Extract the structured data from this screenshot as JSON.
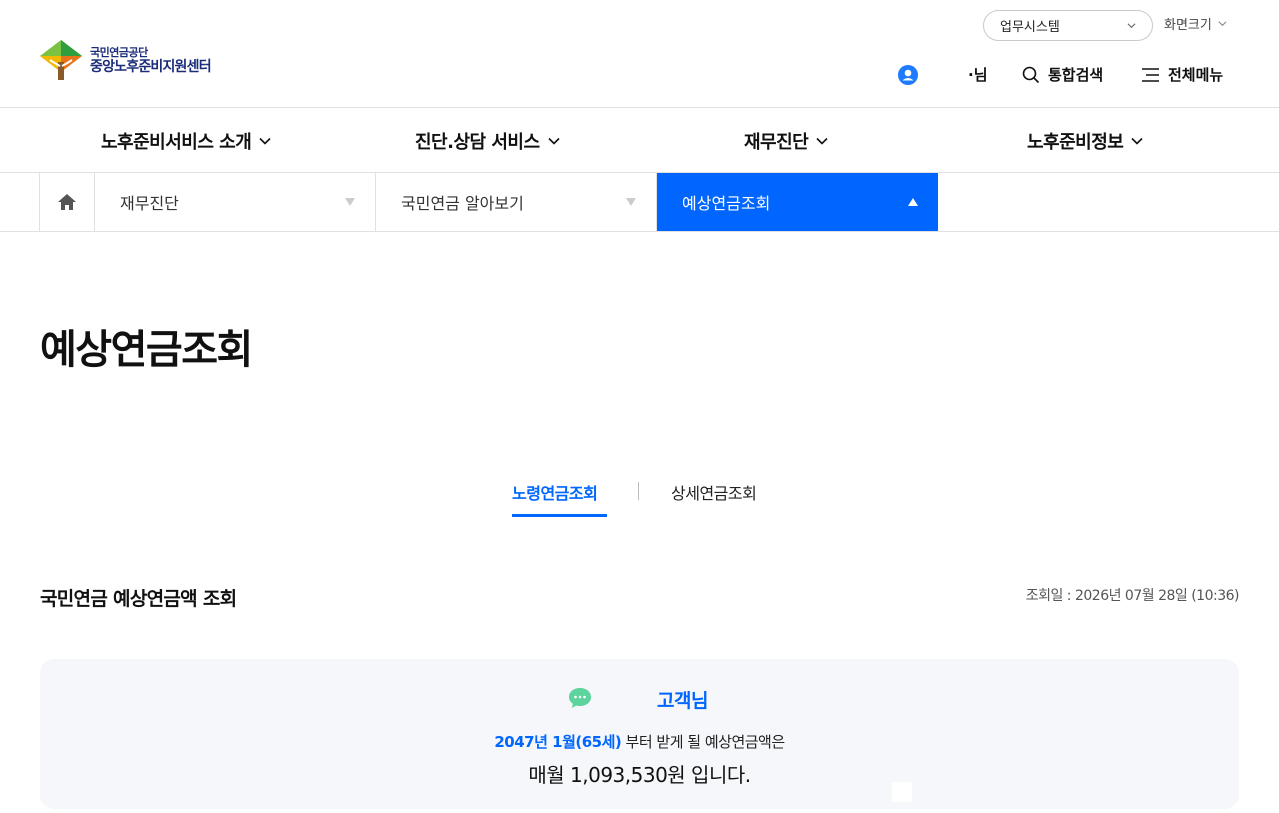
{
  "header": {
    "logo_top": "국민연금공단",
    "logo_bottom": "중앙노후준비지원센터",
    "biz_system": "업무시스템",
    "screen_size": "화면크기",
    "user_name": "·님",
    "search": "통합검색",
    "all_menu": "전체메뉴"
  },
  "gnb": [
    {
      "label": "노후준비서비스 소개"
    },
    {
      "label": "진단.상담 서비스"
    },
    {
      "label": "재무진단"
    },
    {
      "label": "노후준비정보"
    }
  ],
  "breadcrumb": {
    "items": [
      {
        "label": "재무진단"
      },
      {
        "label": "국민연금 알아보기"
      },
      {
        "label": "예상연금조회"
      }
    ]
  },
  "page": {
    "title": "예상연금조회"
  },
  "tabs": [
    {
      "label": "노령연금조회",
      "active": true
    },
    {
      "label": "상세연금조회",
      "active": false
    }
  ],
  "section": {
    "title": "국민연금 예상연금액 조회",
    "query_date": "조회일 : 2026년 07월 28일 (10:36)"
  },
  "result": {
    "customer": "고객님",
    "start_highlight": "2047년 1월(65세)",
    "start_rest": " 부터 받게 될 예상연금액은",
    "amount_line": "매월 1,093,530원 입니다."
  },
  "colors": {
    "accent": "#0066ff",
    "brand_navy": "#1b2c7a",
    "bubble_green": "#5dd39e",
    "box_bg": "#f5f7fa"
  }
}
